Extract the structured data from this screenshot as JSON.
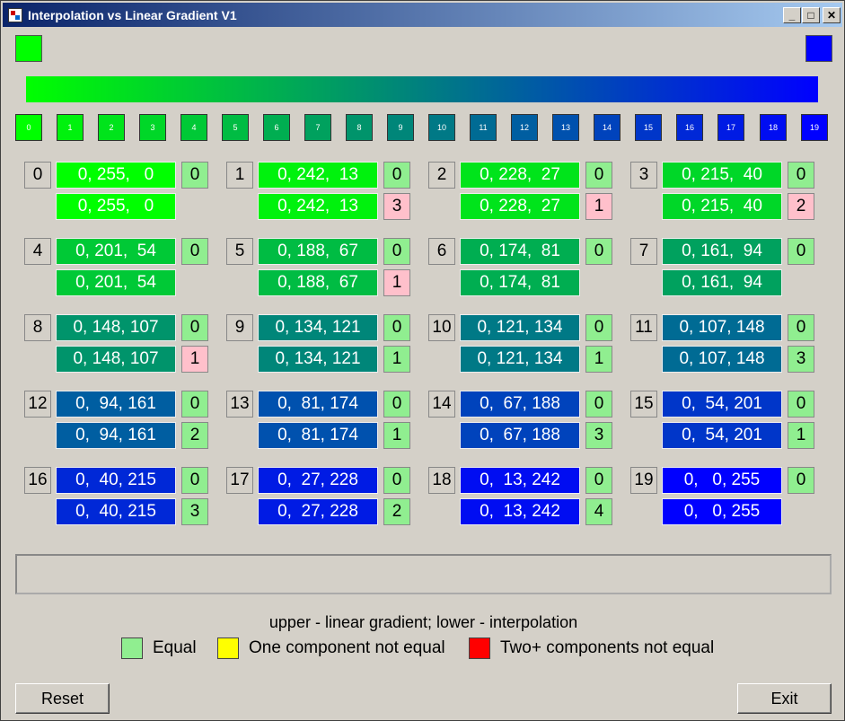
{
  "window": {
    "title": "Interpolation vs Linear Gradient V1"
  },
  "colors": {
    "start": "#00ff00",
    "end": "#0000ff",
    "equal": "#90ee90",
    "mismatch": "#ffc0cb",
    "one_not_equal": "#ffff00",
    "two_not_equal": "#ff0000"
  },
  "steps": [
    {
      "index": "0",
      "linear": "0, 255,   0",
      "linear_color": "#00ff00",
      "interp": "0, 255,   0",
      "interp_color": "#00ff00",
      "upper_diff": "0",
      "lower_diff": ""
    },
    {
      "index": "1",
      "linear": "0, 242,  13",
      "linear_color": "#00f20d",
      "interp": "0, 242,  13",
      "interp_color": "#00f20d",
      "upper_diff": "0",
      "lower_diff": "3"
    },
    {
      "index": "2",
      "linear": "0, 228,  27",
      "linear_color": "#00e41b",
      "interp": "0, 228,  27",
      "interp_color": "#00e41b",
      "upper_diff": "0",
      "lower_diff": "1"
    },
    {
      "index": "3",
      "linear": "0, 215,  40",
      "linear_color": "#00d728",
      "interp": "0, 215,  40",
      "interp_color": "#00d728",
      "upper_diff": "0",
      "lower_diff": "2"
    },
    {
      "index": "4",
      "linear": "0, 201,  54",
      "linear_color": "#00c936",
      "interp": "0, 201,  54",
      "interp_color": "#00c936",
      "upper_diff": "0",
      "lower_diff": ""
    },
    {
      "index": "5",
      "linear": "0, 188,  67",
      "linear_color": "#00bc43",
      "interp": "0, 188,  67",
      "interp_color": "#00bc43",
      "upper_diff": "0",
      "lower_diff": "1"
    },
    {
      "index": "6",
      "linear": "0, 174,  81",
      "linear_color": "#00ae51",
      "interp": "0, 174,  81",
      "interp_color": "#00ae51",
      "upper_diff": "0",
      "lower_diff": ""
    },
    {
      "index": "7",
      "linear": "0, 161,  94",
      "linear_color": "#00a15e",
      "interp": "0, 161,  94",
      "interp_color": "#00a15e",
      "upper_diff": "0",
      "lower_diff": ""
    },
    {
      "index": "8",
      "linear": "0, 148, 107",
      "linear_color": "#00946b",
      "interp": "0, 148, 107",
      "interp_color": "#00946b",
      "upper_diff": "0",
      "lower_diff": "1"
    },
    {
      "index": "9",
      "linear": "0, 134, 121",
      "linear_color": "#008679",
      "interp": "0, 134, 121",
      "interp_color": "#008679",
      "upper_diff": "0",
      "lower_diff": "1"
    },
    {
      "index": "10",
      "linear": "0, 121, 134",
      "linear_color": "#007986",
      "interp": "0, 121, 134",
      "interp_color": "#007986",
      "upper_diff": "0",
      "lower_diff": "1"
    },
    {
      "index": "11",
      "linear": "0, 107, 148",
      "linear_color": "#006b94",
      "interp": "0, 107, 148",
      "interp_color": "#006b94",
      "upper_diff": "0",
      "lower_diff": "3"
    },
    {
      "index": "12",
      "linear": "0,  94, 161",
      "linear_color": "#005ea1",
      "interp": "0,  94, 161",
      "interp_color": "#005ea1",
      "upper_diff": "0",
      "lower_diff": "2"
    },
    {
      "index": "13",
      "linear": "0,  81, 174",
      "linear_color": "#0051ae",
      "interp": "0,  81, 174",
      "interp_color": "#0051ae",
      "upper_diff": "0",
      "lower_diff": "1"
    },
    {
      "index": "14",
      "linear": "0,  67, 188",
      "linear_color": "#0043bc",
      "interp": "0,  67, 188",
      "interp_color": "#0043bc",
      "upper_diff": "0",
      "lower_diff": "3"
    },
    {
      "index": "15",
      "linear": "0,  54, 201",
      "linear_color": "#0036c9",
      "interp": "0,  54, 201",
      "interp_color": "#0036c9",
      "upper_diff": "0",
      "lower_diff": "1"
    },
    {
      "index": "16",
      "linear": "0,  40, 215",
      "linear_color": "#0028d7",
      "interp": "0,  40, 215",
      "interp_color": "#0028d7",
      "upper_diff": "0",
      "lower_diff": "3"
    },
    {
      "index": "17",
      "linear": "0,  27, 228",
      "linear_color": "#001be4",
      "interp": "0,  27, 228",
      "interp_color": "#001be4",
      "upper_diff": "0",
      "lower_diff": "2"
    },
    {
      "index": "18",
      "linear": "0,  13, 242",
      "linear_color": "#000df2",
      "interp": "0,  13, 242",
      "interp_color": "#000df2",
      "upper_diff": "0",
      "lower_diff": "4"
    },
    {
      "index": "19",
      "linear": "0,   0, 255",
      "linear_color": "#0000ff",
      "interp": "0,   0, 255",
      "interp_color": "#0000ff",
      "upper_diff": "0",
      "lower_diff": ""
    }
  ],
  "status_text": "",
  "legend": {
    "title": "upper - linear gradient; lower - interpolation",
    "items": [
      {
        "label": "Equal",
        "color": "#90ee90"
      },
      {
        "label": "One component not equal",
        "color": "#ffff00"
      },
      {
        "label": "Two+ components not equal",
        "color": "#ff0000"
      }
    ]
  },
  "buttons": {
    "reset": "Reset",
    "exit": "Exit"
  }
}
